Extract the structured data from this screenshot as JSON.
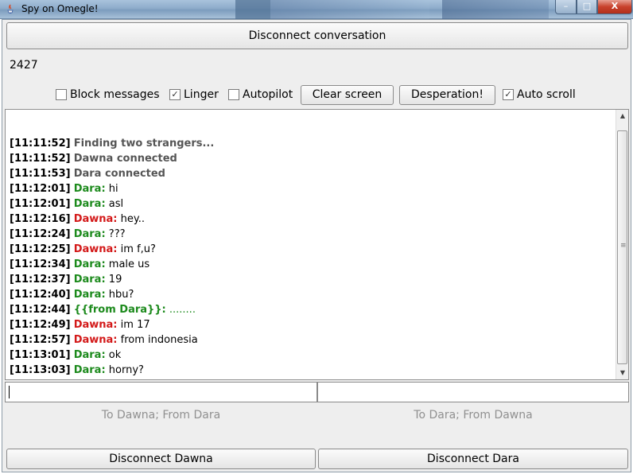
{
  "window": {
    "title": "Spy on Omegle!",
    "minimize_label": "–",
    "maximize_label": "□",
    "close_label": "X"
  },
  "toolbar": {
    "disconnect_conversation_label": "Disconnect conversation",
    "counter": "2427",
    "options": [
      {
        "label": "Block messages",
        "checked": false
      },
      {
        "label": "Linger",
        "checked": true
      },
      {
        "label": "Autopilot",
        "checked": false
      }
    ],
    "clear_screen_label": "Clear screen",
    "desperation_label": "Desperation!",
    "auto_scroll": {
      "label": "Auto scroll",
      "checked": true
    }
  },
  "log": {
    "lines": [
      {
        "time": "[11:11:52]",
        "text": "Finding two strangers...",
        "type": "system"
      },
      {
        "time": "[11:11:52]",
        "text": "Dawna connected",
        "type": "system"
      },
      {
        "time": "[11:11:53]",
        "text": "Dara connected",
        "type": "system"
      },
      {
        "time": "[11:12:01]",
        "who": "Dara:",
        "text": "hi",
        "type": "dara"
      },
      {
        "time": "[11:12:01]",
        "who": "Dara:",
        "text": "asl",
        "type": "dara"
      },
      {
        "time": "[11:12:16]",
        "who": "Dawna:",
        "text": "hey..",
        "type": "dawna"
      },
      {
        "time": "[11:12:24]",
        "who": "Dara:",
        "text": "???",
        "type": "dara"
      },
      {
        "time": "[11:12:25]",
        "who": "Dawna:",
        "text": "im f,u?",
        "type": "dawna"
      },
      {
        "time": "[11:12:34]",
        "who": "Dara:",
        "text": "male us",
        "type": "dara"
      },
      {
        "time": "[11:12:37]",
        "who": "Dara:",
        "text": "19",
        "type": "dara"
      },
      {
        "time": "[11:12:40]",
        "who": "Dara:",
        "text": "hbu?",
        "type": "dara"
      },
      {
        "time": "[11:12:44]",
        "who": "{{from Dara}}:",
        "text": "........",
        "type": "fromdara"
      },
      {
        "time": "[11:12:49]",
        "who": "Dawna:",
        "text": "im 17",
        "type": "dawna"
      },
      {
        "time": "[11:12:57]",
        "who": "Dawna:",
        "text": "from indonesia",
        "type": "dawna"
      },
      {
        "time": "[11:13:01]",
        "who": "Dara:",
        "text": "ok",
        "type": "dara"
      },
      {
        "time": "[11:13:03]",
        "who": "Dara:",
        "text": "horny?",
        "type": "dara"
      }
    ]
  },
  "inputs": {
    "left_value": "",
    "right_value": "",
    "left_hint": "To Dawna; From Dara",
    "right_hint": "To Dara; From Dawna"
  },
  "footer": {
    "disconnect_dawna_label": "Disconnect Dawna",
    "disconnect_dara_label": "Disconnect Dara"
  },
  "colors": {
    "dara": "#1c8a1c",
    "dawna": "#d31919",
    "system": "#555555"
  }
}
